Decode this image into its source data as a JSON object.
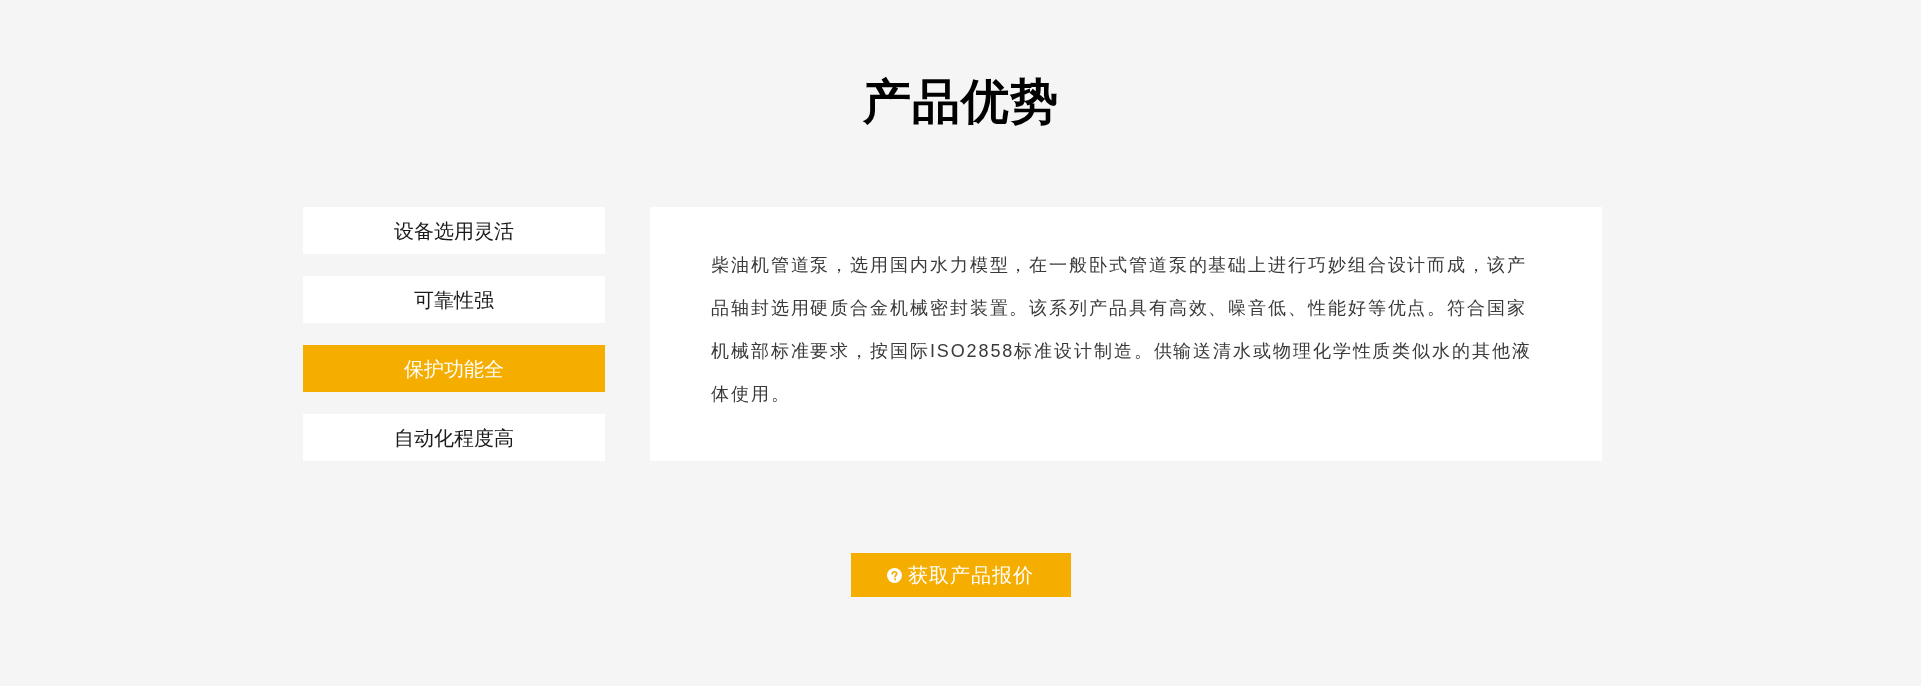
{
  "title": "产品优势",
  "tabs": [
    {
      "label": "设备选用灵活",
      "selected": false
    },
    {
      "label": "可靠性强",
      "selected": false
    },
    {
      "label": "保护功能全",
      "selected": true
    },
    {
      "label": "自动化程度高",
      "selected": false
    }
  ],
  "panel": {
    "text": "柴油机管道泵，选用国内水力模型，在一般卧式管道泵的基础上进行巧妙组合设计而成，该产品轴封选用硬质合金机械密封装置。该系列产品具有高效、噪音低、性能好等优点。符合国家机械部标准要求，按国际ISO2858标准设计制造。供输送清水或物理化学性质类似水的其他液体使用。"
  },
  "quote_button": {
    "label": "获取产品报价"
  }
}
